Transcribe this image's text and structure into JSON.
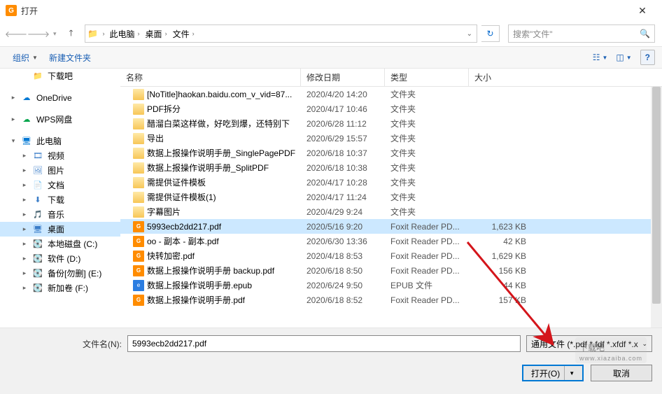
{
  "window": {
    "title": "打开"
  },
  "breadcrumb": {
    "items": [
      "此电脑",
      "桌面",
      "文件"
    ]
  },
  "search": {
    "placeholder": "搜索\"文件\""
  },
  "toolbar": {
    "organize": "组织",
    "newfolder": "新建文件夹"
  },
  "columns": {
    "name": "名称",
    "date": "修改日期",
    "type": "类型",
    "size": "大小"
  },
  "sidebar": [
    {
      "label": "下载吧",
      "icon": "folder",
      "lvl": 1,
      "exp": ""
    },
    {
      "label": "OneDrive",
      "icon": "cloud-blue",
      "lvl": 0,
      "exp": "▸"
    },
    {
      "label": "WPS网盘",
      "icon": "cloud-green",
      "lvl": 0,
      "exp": "▸"
    },
    {
      "label": "此电脑",
      "icon": "pc",
      "lvl": 0,
      "exp": "▾"
    },
    {
      "label": "视频",
      "icon": "video",
      "lvl": 1,
      "exp": "▸"
    },
    {
      "label": "图片",
      "icon": "pic",
      "lvl": 1,
      "exp": "▸"
    },
    {
      "label": "文档",
      "icon": "doc",
      "lvl": 1,
      "exp": "▸"
    },
    {
      "label": "下载",
      "icon": "down",
      "lvl": 1,
      "exp": "▸"
    },
    {
      "label": "音乐",
      "icon": "music",
      "lvl": 1,
      "exp": "▸"
    },
    {
      "label": "桌面",
      "icon": "desktop",
      "lvl": 1,
      "exp": "▸",
      "selected": true
    },
    {
      "label": "本地磁盘 (C:)",
      "icon": "disk",
      "lvl": 1,
      "exp": "▸"
    },
    {
      "label": "软件 (D:)",
      "icon": "disk",
      "lvl": 1,
      "exp": "▸"
    },
    {
      "label": "备份[勿删] (E:)",
      "icon": "disk",
      "lvl": 1,
      "exp": "▸"
    },
    {
      "label": "新加卷 (F:)",
      "icon": "disk",
      "lvl": 1,
      "exp": "▸"
    }
  ],
  "files": [
    {
      "name": "[NoTitle]haokan.baidu.com_v_vid=87...",
      "date": "2020/4/20 14:20",
      "type": "文件夹",
      "size": "",
      "icon": "folder"
    },
    {
      "name": "PDF拆分",
      "date": "2020/4/17 10:46",
      "type": "文件夹",
      "size": "",
      "icon": "folder"
    },
    {
      "name": "醋溜白菜这样做，好吃到爆，还特别下",
      "date": "2020/6/28 11:12",
      "type": "文件夹",
      "size": "",
      "icon": "folder"
    },
    {
      "name": "导出",
      "date": "2020/6/29 15:57",
      "type": "文件夹",
      "size": "",
      "icon": "folder"
    },
    {
      "name": "数据上报操作说明手册_SinglePagePDF",
      "date": "2020/6/18 10:37",
      "type": "文件夹",
      "size": "",
      "icon": "folder"
    },
    {
      "name": "数据上报操作说明手册_SplitPDF",
      "date": "2020/6/18 10:38",
      "type": "文件夹",
      "size": "",
      "icon": "folder"
    },
    {
      "name": "需提供证件模板",
      "date": "2020/4/17 10:28",
      "type": "文件夹",
      "size": "",
      "icon": "folder"
    },
    {
      "name": "需提供证件模板(1)",
      "date": "2020/4/17 11:24",
      "type": "文件夹",
      "size": "",
      "icon": "folder"
    },
    {
      "name": "字幕图片",
      "date": "2020/4/29 9:24",
      "type": "文件夹",
      "size": "",
      "icon": "folder"
    },
    {
      "name": "5993ecb2dd217.pdf",
      "date": "2020/5/16 9:20",
      "type": "Foxit Reader PD...",
      "size": "1,623 KB",
      "icon": "pdf",
      "selected": true
    },
    {
      "name": "oo - 副本 - 副本.pdf",
      "date": "2020/6/30 13:36",
      "type": "Foxit Reader PD...",
      "size": "42 KB",
      "icon": "pdf"
    },
    {
      "name": "快转加密.pdf",
      "date": "2020/4/18 8:53",
      "type": "Foxit Reader PD...",
      "size": "1,629 KB",
      "icon": "pdf"
    },
    {
      "name": "数据上报操作说明手册 backup.pdf",
      "date": "2020/6/18 8:50",
      "type": "Foxit Reader PD...",
      "size": "156 KB",
      "icon": "pdf"
    },
    {
      "name": "数据上报操作说明手册.epub",
      "date": "2020/6/24 9:50",
      "type": "EPUB 文件",
      "size": "44 KB",
      "icon": "epub"
    },
    {
      "name": "数据上报操作说明手册.pdf",
      "date": "2020/6/18 8:52",
      "type": "Foxit Reader PD...",
      "size": "157 KB",
      "icon": "pdf"
    }
  ],
  "bottom": {
    "filename_label": "文件名(N):",
    "filename_value": "5993ecb2dd217.pdf",
    "filetype": "通用文件 (*.pdf *.fdf *.xfdf *.x",
    "open": "打开(O)",
    "cancel": "取消"
  },
  "watermark": {
    "main": "下载吧",
    "sub": "www.xiazaiba.com"
  }
}
